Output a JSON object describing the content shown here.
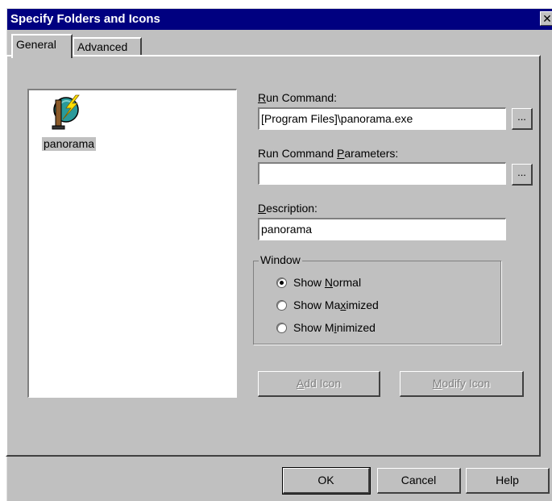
{
  "window": {
    "title": "Specify Folders and Icons",
    "close_glyph": "✕"
  },
  "tabs": [
    {
      "label": "General",
      "active": true
    },
    {
      "label": "Advanced",
      "active": false
    }
  ],
  "icon_list": [
    {
      "label": "panorama",
      "icon": "panorama-app-icon",
      "selected": true
    }
  ],
  "run_command": {
    "label_pre": "",
    "label_u": "R",
    "label_post": "un Command:",
    "value": "[Program Files]\\panorama.exe",
    "browse_label": "..."
  },
  "run_params": {
    "label_pre": "Run Command ",
    "label_u": "P",
    "label_post": "arameters:",
    "value": "",
    "browse_label": "..."
  },
  "description": {
    "label_pre": "",
    "label_u": "D",
    "label_post": "escription:",
    "value": "panorama"
  },
  "window_group": {
    "legend": "Window",
    "options": [
      {
        "pre": "Show ",
        "u": "N",
        "post": "ormal",
        "checked": true
      },
      {
        "pre": "Show Ma",
        "u": "x",
        "post": "imized",
        "checked": false
      },
      {
        "pre": "Show M",
        "u": "i",
        "post": "nimized",
        "checked": false
      }
    ]
  },
  "buttons": {
    "add_icon": {
      "pre": "",
      "u": "A",
      "post": "dd Icon",
      "enabled": false
    },
    "modify_icon": {
      "pre": "",
      "u": "M",
      "post": "odify Icon",
      "enabled": false
    },
    "ok": "OK",
    "cancel": "Cancel",
    "help": "Help"
  },
  "colors": {
    "titlebar": "#000080",
    "face": "#c0c0c0"
  }
}
